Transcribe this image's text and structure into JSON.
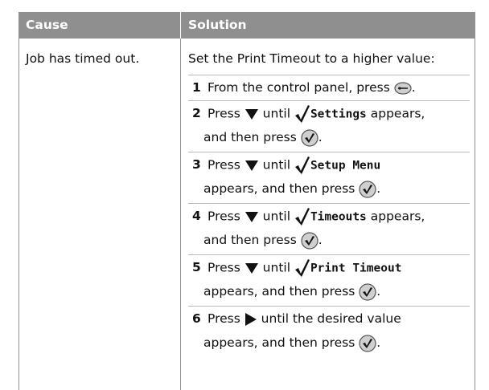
{
  "table": {
    "headers": {
      "cause": "Cause",
      "solution": "Solution"
    },
    "cause": "Job has timed out.",
    "intro": "Set the Print Timeout to a higher value:",
    "steps": [
      {
        "num": "1",
        "a": "From the control panel, press",
        "b": "."
      },
      {
        "num": "2",
        "a": "Press",
        "b": "until",
        "menu": "Settings",
        "c": "appears,",
        "d": "and then press",
        "e": "."
      },
      {
        "num": "3",
        "a": "Press",
        "b": "until",
        "menu": "Setup Menu",
        "d": "appears, and then press",
        "e": "."
      },
      {
        "num": "4",
        "a": "Press",
        "b": "until",
        "menu": "Timeouts",
        "c": "appears,",
        "d": "and then press",
        "e": "."
      },
      {
        "num": "5",
        "a": "Press",
        "b": "until",
        "menu": "Print Timeout",
        "d": "appears, and then press",
        "e": "."
      },
      {
        "num": "6",
        "a": "Press",
        "b": "until the desired value",
        "d": "appears, and then press",
        "e": "."
      }
    ]
  },
  "icons": {
    "menu_button": "menu-button-icon",
    "down_arrow": "down-arrow-icon",
    "right_arrow": "right-arrow-icon",
    "checkmark": "checkmark-icon",
    "select_button": "select-button-icon"
  },
  "colors": {
    "header_bg": "#8f8f8f",
    "header_text": "#ffffff",
    "row_rule": "#b9b9b9"
  }
}
